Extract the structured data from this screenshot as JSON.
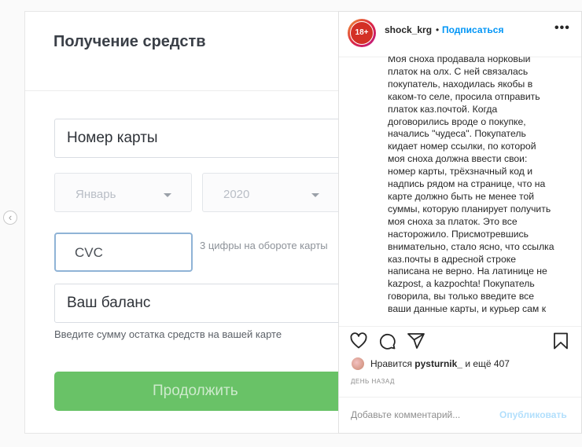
{
  "carousel": {
    "prev_icon": "‹"
  },
  "form": {
    "title": "Получение средств",
    "card_number": "Номер карты",
    "month": "Январь",
    "year": "2020",
    "cvc": "CVC",
    "cvc_hint": "3 цифры на обороте карты",
    "balance": "Ваш баланс",
    "balance_hint": "Введите сумму остатка средств на вашей карте",
    "continue_label": "Продолжить"
  },
  "post": {
    "avatar_text": "18+",
    "username": "shock_krg",
    "separator": "•",
    "follow_label": "Подписаться",
    "more_label": "•••",
    "caption": "Моя сноха продавала норковый\nплаток на олх. С ней связалась\nпокупатель, находилась якобы в\nкаком-то селе, просила отправить\nплаток каз.почтой. Когда\nдоговорились вроде о покупке,\nначались \"чудеса\". Покупатель\nкидает номер ссылки, по которой\nмоя сноха должна ввести свои:\nномер карты, трёхзначный код и\nнадпись рядом на странице, что на\nкарте должно быть не менее той\nсуммы, которую планирует получить\nмоя сноха за платок. Это все\nнасторожило. Присмотревшись\nвнимательно, стало ясно, что ссылка\nказ.почты в адресной строке\nнаписана не верно. На латинице не\nkazpost, а kazpochta! Покупатель\nговорила, вы только введите все\nваши данные карты, и курьер сам к",
    "likes_prefix": "Нравится",
    "likes_user": "pysturnik_",
    "likes_suffix": "и ещё 407",
    "timestamp": "ДЕНЬ НАЗАД",
    "comment_placeholder": "Добавьте комментарий...",
    "publish_label": "Опубликовать"
  },
  "colors": {
    "accent": "#0095f6",
    "button_green": "#69c267",
    "focus_border": "#8fb3d6"
  },
  "icons": [
    "chevron-left-icon",
    "heart-icon",
    "comment-icon",
    "share-icon",
    "bookmark-icon",
    "more-icon",
    "caret-down-icon"
  ]
}
